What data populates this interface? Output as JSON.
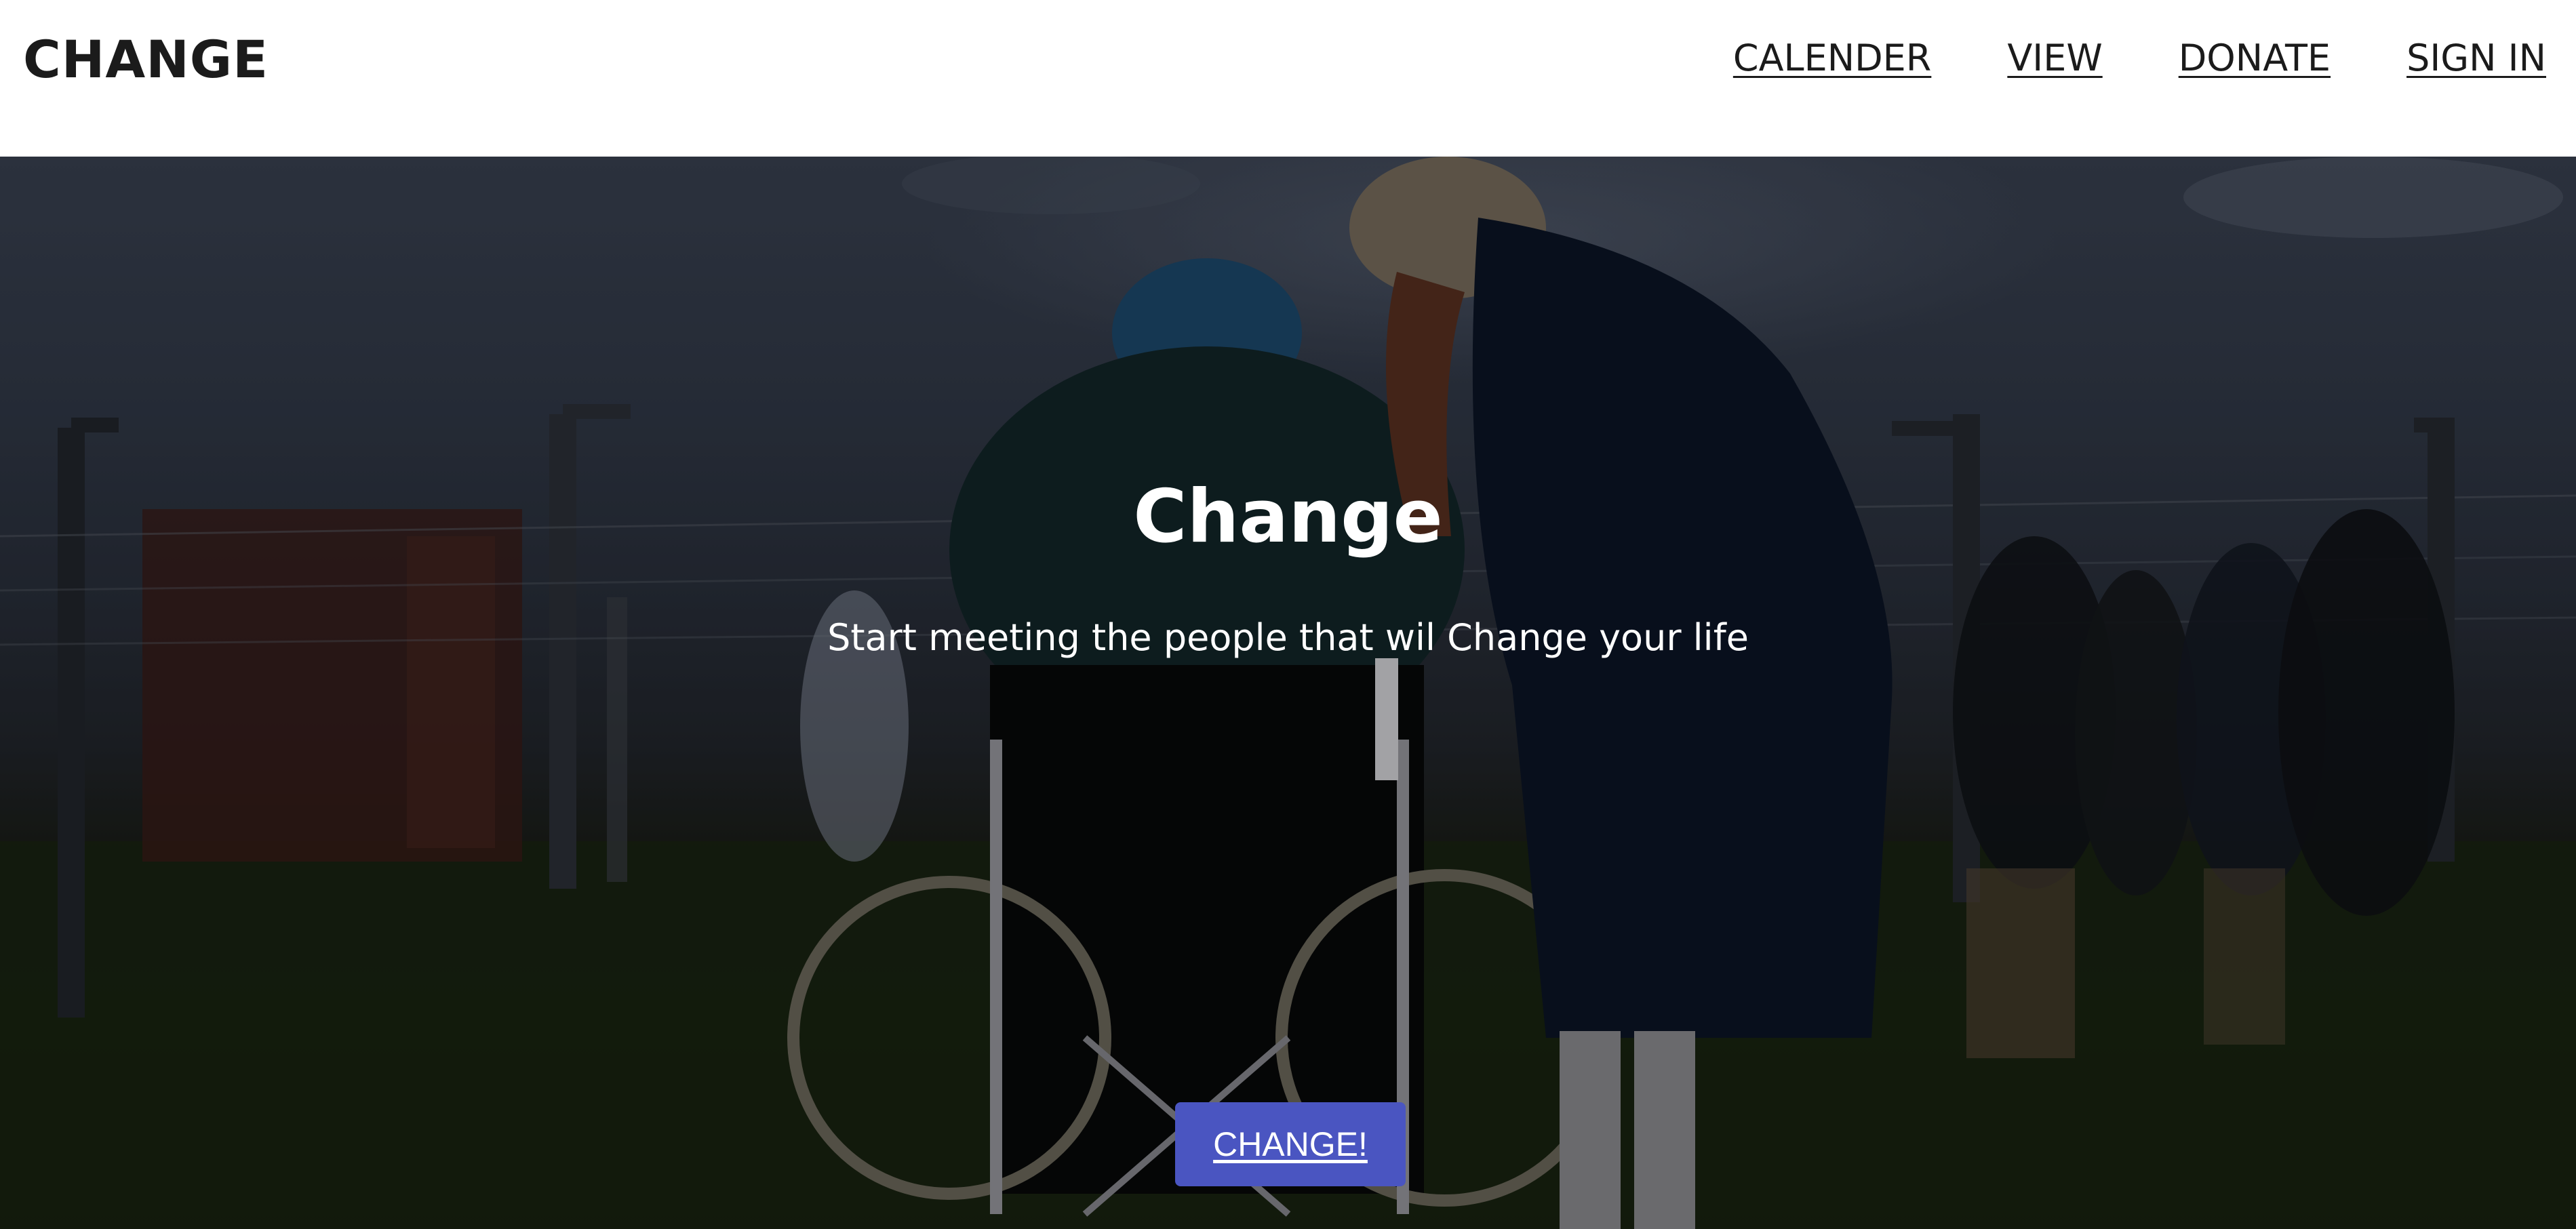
{
  "header": {
    "logo": "CHANGE",
    "nav": [
      {
        "label": "CALENDER"
      },
      {
        "label": "VIEW"
      },
      {
        "label": "DONATE"
      },
      {
        "label": "SIGN IN"
      }
    ]
  },
  "hero": {
    "title": "Change",
    "subtitle": "Start meeting the people that wil Change your life",
    "cta_label": "CHANGE!",
    "image": "photo of a woman leaning over a person in a wheelchair outdoors",
    "colors": {
      "cta_background": "#4a55c1",
      "text": "#ffffff"
    }
  }
}
